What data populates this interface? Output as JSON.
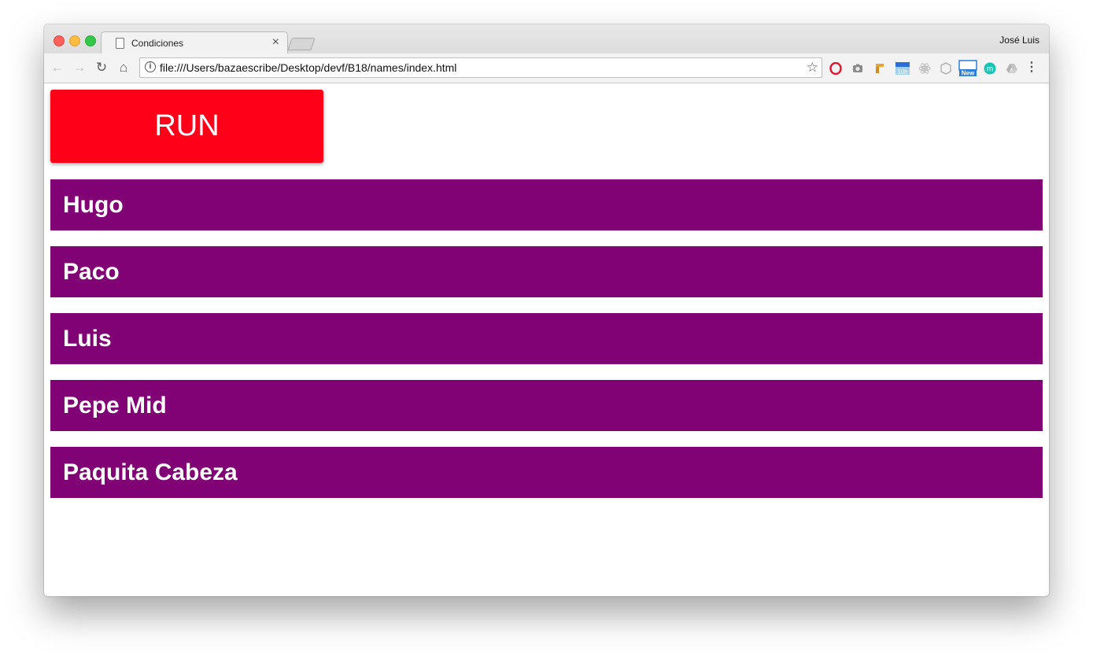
{
  "browser": {
    "tab_title": "Condiciones",
    "tab_close": "×",
    "profile_name": "José Luis",
    "url": "file:///Users/bazaescribe/Desktop/devf/B18/names/index.html"
  },
  "page": {
    "run_button_label": "RUN",
    "run_button_color": "#ff0019",
    "row_color": "#800275",
    "names": [
      "Hugo",
      "Paco",
      "Luis",
      "Pepe Mid",
      "Paquita Cabeza"
    ]
  },
  "extensions": {
    "calendar_badge": "10h",
    "new_badge": "New",
    "m_badge": "m"
  }
}
